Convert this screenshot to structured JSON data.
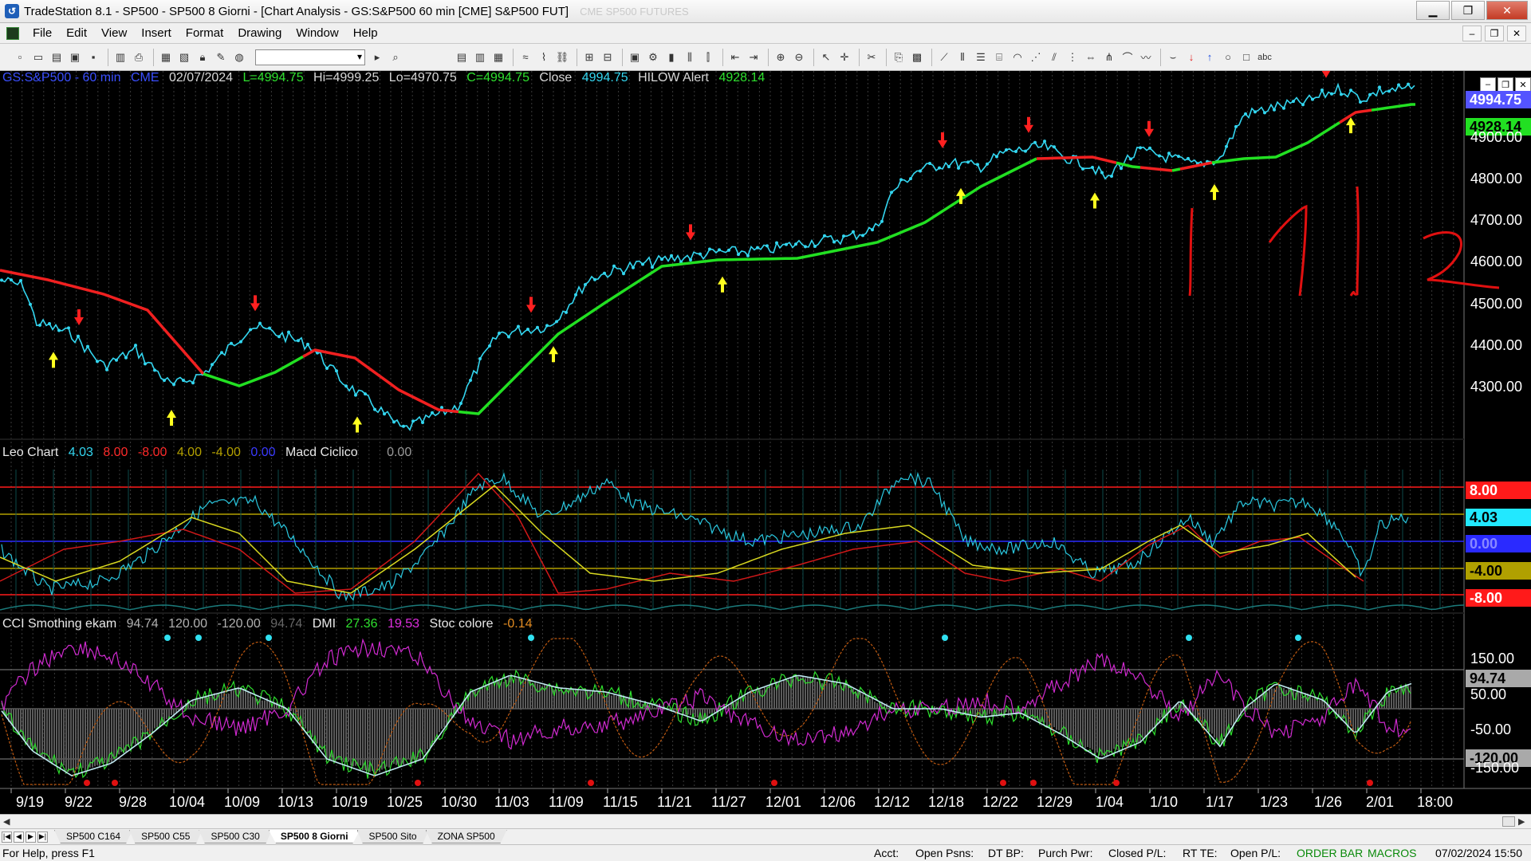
{
  "window": {
    "title": "TradeStation 8.1 - SP500 - SP500 8 Giorni - [Chart Analysis - GS:S&P500  60 min  [CME] S&P500 FUT]",
    "title_ghost": "CME SP500 FUTURES",
    "minimize": "▁",
    "restore": "❐",
    "close": "✕"
  },
  "menu": {
    "items": [
      "File",
      "Edit",
      "View",
      "Insert",
      "Format",
      "Drawing",
      "Window",
      "Help"
    ],
    "mdi_min": "–",
    "mdi_restore": "❐",
    "mdi_close": "✕"
  },
  "chart": {
    "header": {
      "symbol": "GS:S&P500 - 60 min",
      "exchange": "CME",
      "date": "02/07/2024",
      "last": "L=4994.75",
      "high": "Hi=4999.25",
      "low": "Lo=4970.75",
      "close_eq": "C=4994.75",
      "close_label": "Close",
      "close_val": "4994.75",
      "alert_label": "HILOW Alert",
      "alert_val": "4928.14"
    },
    "price_axis": [
      "4900.00",
      "4800.00",
      "4700.00",
      "4600.00",
      "4500.00",
      "4400.00",
      "4300.00"
    ],
    "price_box_1": "4994.75",
    "price_box_2": "4928.14",
    "leo_header": {
      "name": "Leo Chart",
      "v1": "4.03",
      "v2": "8.00",
      "v3": "-8.00",
      "v4": "4.00",
      "v5": "-4.00",
      "v6": "0.00",
      "name2": "Macd Ciclico",
      "v7": "0.00"
    },
    "leo_axis": {
      "a1": "8.00",
      "a2": "4.03",
      "a3": "0.00",
      "a4": "-4.00",
      "a5": "-8.00"
    },
    "cci_header": {
      "name": "CCI Smothing ekam",
      "v1": "94.74",
      "v2": "120.00",
      "v3": "-120.00",
      "v4": "94.74",
      "name2": "DMI",
      "v5": "27.36",
      "v6": "19.53",
      "name3": "Stoc colore",
      "v7": "-0.14"
    },
    "cci_axis": {
      "a1": "150.00",
      "a2": "94.74",
      "a3": "50.00",
      "a4": "-50.00",
      "a5": "-120.00",
      "a6": "-150.00"
    },
    "dates": [
      "9/19",
      "9/22",
      "9/28",
      "10/04",
      "10/09",
      "10/13",
      "10/19",
      "10/25",
      "10/30",
      "11/03",
      "11/09",
      "11/15",
      "11/21",
      "11/27",
      "12/01",
      "12/06",
      "12/12",
      "12/18",
      "12/22",
      "12/29",
      "1/04",
      "1/10",
      "1/17",
      "1/23",
      "1/26",
      "2/01",
      "18:00"
    ],
    "colors": {
      "price": "#33d6f0",
      "avg_up": "#22e022",
      "avg_down": "#f02020",
      "signal_down": "#ff2020",
      "signal_up": "#ffff20"
    }
  },
  "tabs": {
    "items": [
      "SP500 C164",
      "SP500 C55",
      "SP500 C30",
      "SP500 8 Giorni",
      "SP500 Sito",
      "ZONA SP500"
    ],
    "active": "SP500 8 Giorni"
  },
  "status": {
    "help": "For Help, press F1",
    "acct": "Acct:",
    "open_psns": "Open Psns:",
    "dt_bp": "DT BP:",
    "purch_pwr": "Purch Pwr:",
    "closed_pl": "Closed P/L:",
    "rt_te": "RT TE:",
    "open_pl": "Open P/L:",
    "order_bar": "ORDER BAR",
    "macros": "MACROS",
    "datetime": "07/02/2024 15:50"
  }
}
